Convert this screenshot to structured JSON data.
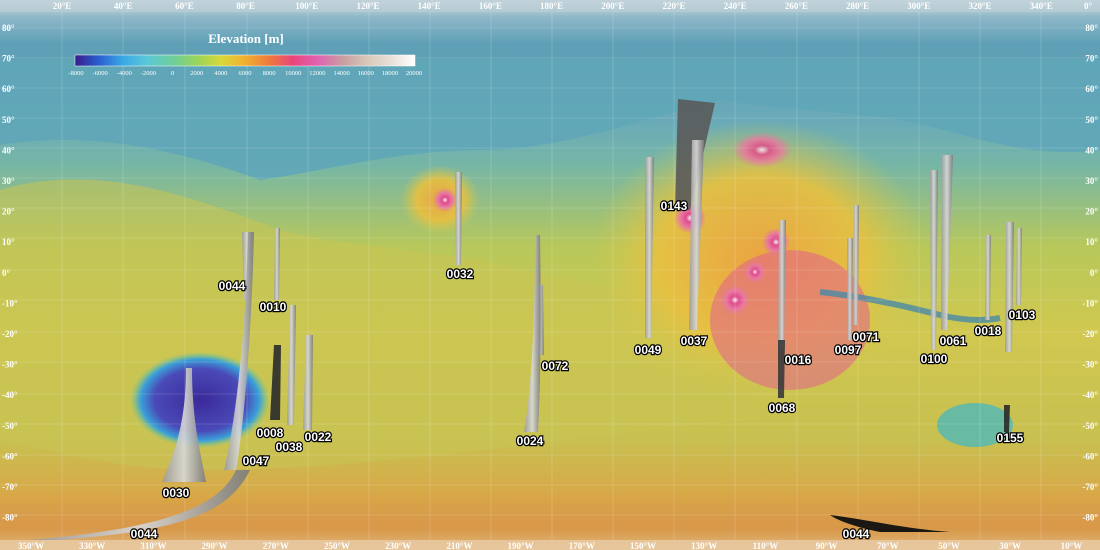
{
  "colorbar": {
    "title": "Elevation [m]",
    "ticks": [
      "-8000",
      "-6000",
      "-4000",
      "-2000",
      "0",
      "2000",
      "4000",
      "6000",
      "8000",
      "10000",
      "12000",
      "14000",
      "16000",
      "18000",
      "20000"
    ],
    "colors": [
      "#3a1a8a",
      "#2a5fd0",
      "#3aa8e6",
      "#5ac8d8",
      "#6fcf9a",
      "#9ad45a",
      "#d8d83a",
      "#f0b030",
      "#f07a3a",
      "#e8467a",
      "#e060b0",
      "#c8a0a0",
      "#d8c8b8",
      "#e8e0d8",
      "#ffffff"
    ]
  },
  "axes": {
    "top_lon": [
      "20°E",
      "40°E",
      "60°E",
      "80°E",
      "100°E",
      "120°E",
      "140°E",
      "160°E",
      "180°E",
      "200°E",
      "220°E",
      "240°E",
      "260°E",
      "280°E",
      "300°E",
      "320°E",
      "340°E"
    ],
    "bottom_lon": [
      "350°W",
      "330°W",
      "310°W",
      "290°W",
      "270°W",
      "250°W",
      "230°W",
      "210°W",
      "190°W",
      "170°W",
      "150°W",
      "130°W",
      "110°W",
      "90°W",
      "70°W",
      "50°W",
      "30°W",
      "10°W"
    ],
    "left_lat": [
      "80°",
      "70°",
      "60°",
      "50°",
      "40°",
      "30°",
      "20°",
      "10°",
      "0°",
      "-10°",
      "-20°",
      "-30°",
      "-40°",
      "-50°",
      "-60°",
      "-70°",
      "-80°"
    ],
    "right_lat": [
      "80°",
      "70°",
      "60°",
      "50°",
      "40°",
      "30°",
      "20°",
      "10°",
      "0°",
      "-10°",
      "-20°",
      "-30°",
      "-40°",
      "-50°",
      "-60°",
      "-70°",
      "-80°"
    ],
    "right_top_lon": "0°"
  },
  "tracks": [
    {
      "id": "0044"
    },
    {
      "id": "0010"
    },
    {
      "id": "0008"
    },
    {
      "id": "0038"
    },
    {
      "id": "0022"
    },
    {
      "id": "0047"
    },
    {
      "id": "0030"
    },
    {
      "id": "0032"
    },
    {
      "id": "0072"
    },
    {
      "id": "0024"
    },
    {
      "id": "0049"
    },
    {
      "id": "0143"
    },
    {
      "id": "0037"
    },
    {
      "id": "0016"
    },
    {
      "id": "0068"
    },
    {
      "id": "0071"
    },
    {
      "id": "0097"
    },
    {
      "id": "0100"
    },
    {
      "id": "0061"
    },
    {
      "id": "0018"
    },
    {
      "id": "0103"
    },
    {
      "id": "0155"
    },
    {
      "id": "0044"
    },
    {
      "id": "0044"
    }
  ]
}
